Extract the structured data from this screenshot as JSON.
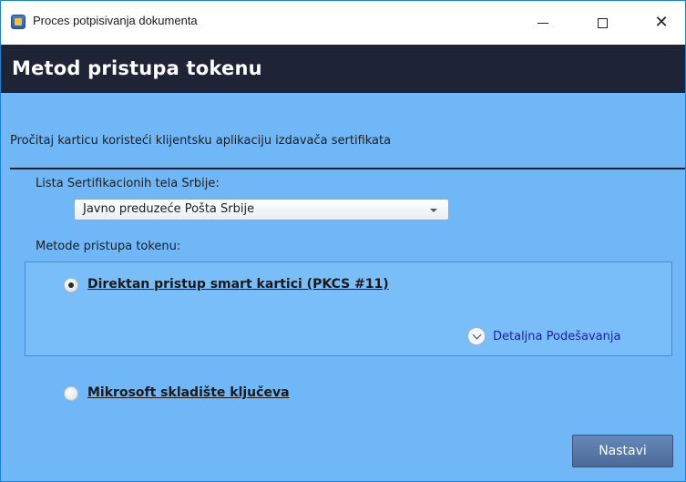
{
  "window": {
    "title": "Proces potpisivanja dokumenta",
    "icon": "app-token-icon",
    "controls": {
      "minimize": "minimize-icon",
      "maximize": "maximize-icon",
      "close": "✕"
    }
  },
  "header": {
    "title": "Metod pristupa tokenu"
  },
  "content": {
    "instruction": "Pročitaj karticu koristeći klijentsku aplikaciju izdavača sertifikata",
    "ca_list": {
      "label": "Lista Sertifikacionih tela Srbije:",
      "selected": "Javno preduzeće Pošta Srbije"
    },
    "methods": {
      "label": "Metode pristupa tokenu:",
      "options": [
        {
          "label": "Direktan pristup smart kartici (PKCS #11)",
          "checked": true
        },
        {
          "label": "Mikrosoft skladište ključeva",
          "checked": false
        }
      ],
      "advanced_settings": "Detaljna Podešavanja"
    }
  },
  "footer": {
    "next_button": "Nastavi"
  },
  "colors": {
    "background": "#6fb7f7",
    "header": "#1f2336",
    "panel": "#79bdf9",
    "button": "#4b6a99",
    "link": "#1b1fa8"
  }
}
